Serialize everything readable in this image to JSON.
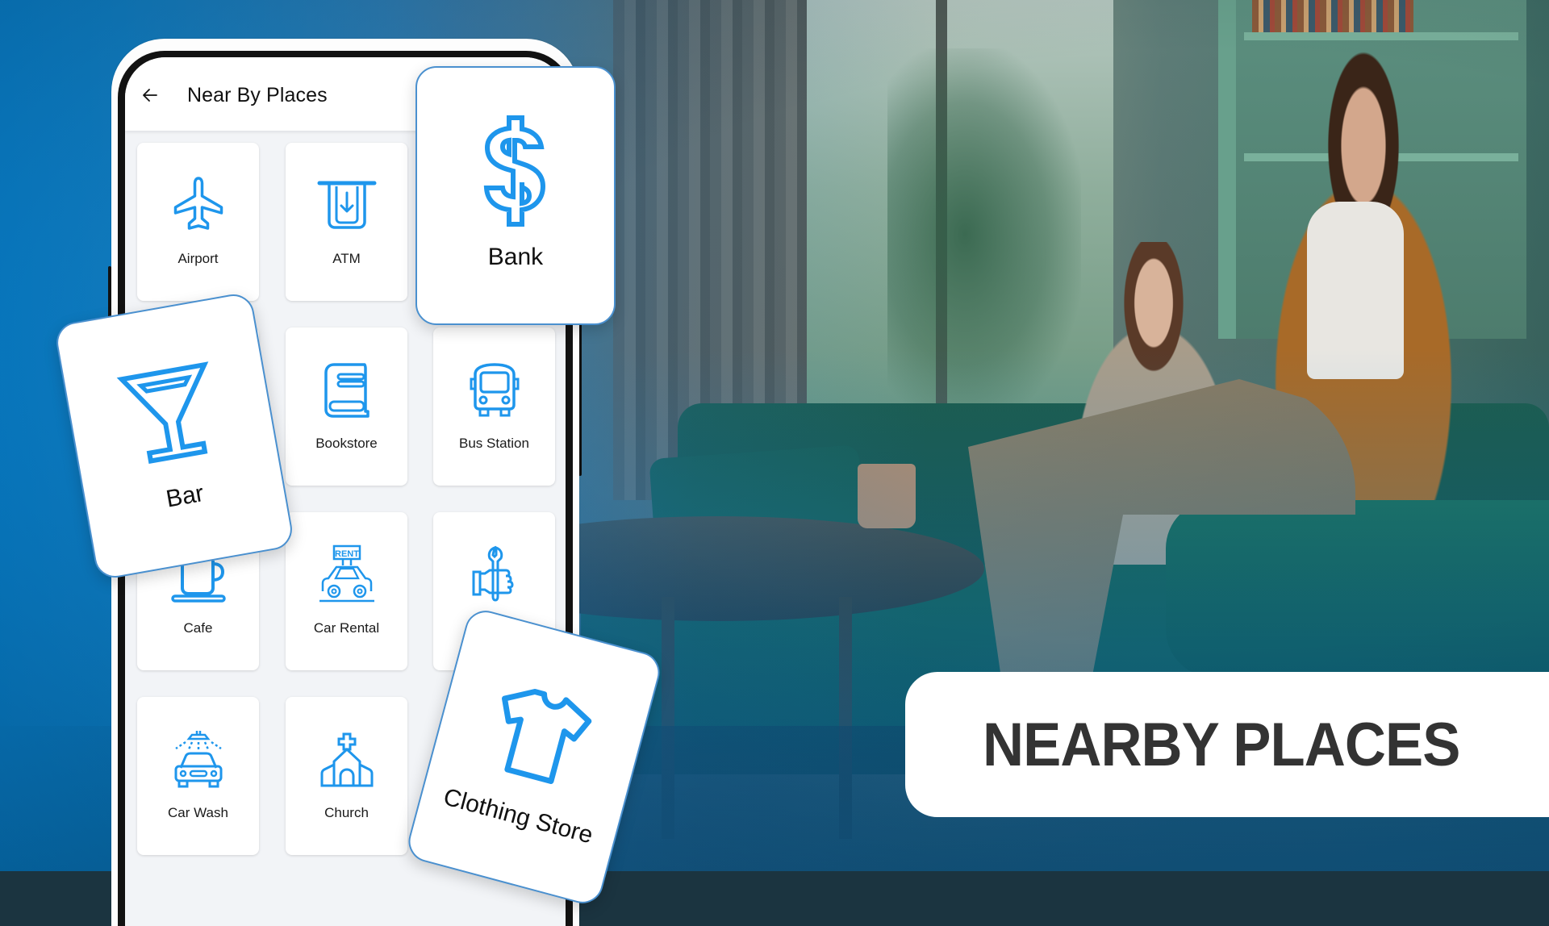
{
  "theme": {
    "icon_color": "#1e96ec",
    "card_border": "#4a90cf",
    "banner_text_color": "#333333",
    "accent_blue": "#078ce1"
  },
  "app": {
    "header": {
      "back_icon": "arrow-left-icon",
      "title": "Near By Places"
    },
    "grid": [
      {
        "label": "Airport",
        "icon": "airplane-icon"
      },
      {
        "label": "ATM",
        "icon": "atm-icon"
      },
      {
        "label": "Bank",
        "icon": "dollar-icon"
      },
      {
        "label": "Bar",
        "icon": "cocktail-glass-icon"
      },
      {
        "label": "Bookstore",
        "icon": "book-icon"
      },
      {
        "label": "Bus Station",
        "icon": "bus-icon"
      },
      {
        "label": "Cafe",
        "icon": "coffee-cup-icon"
      },
      {
        "label": "Car Rental",
        "icon": "car-rental-icon",
        "icon_text": "RENT"
      },
      {
        "label": "",
        "icon": "hand-wrench-icon"
      },
      {
        "label": "Car Wash",
        "icon": "car-wash-icon"
      },
      {
        "label": "Church",
        "icon": "church-icon"
      }
    ]
  },
  "floating_cards": {
    "bank": {
      "label": "Bank",
      "icon": "dollar-icon"
    },
    "bar": {
      "label": "Bar",
      "icon": "cocktail-glass-icon"
    },
    "clothing": {
      "label": "Clothing Store",
      "icon": "t-shirt-icon"
    }
  },
  "banner": {
    "text": "NEARBY PLACES"
  }
}
